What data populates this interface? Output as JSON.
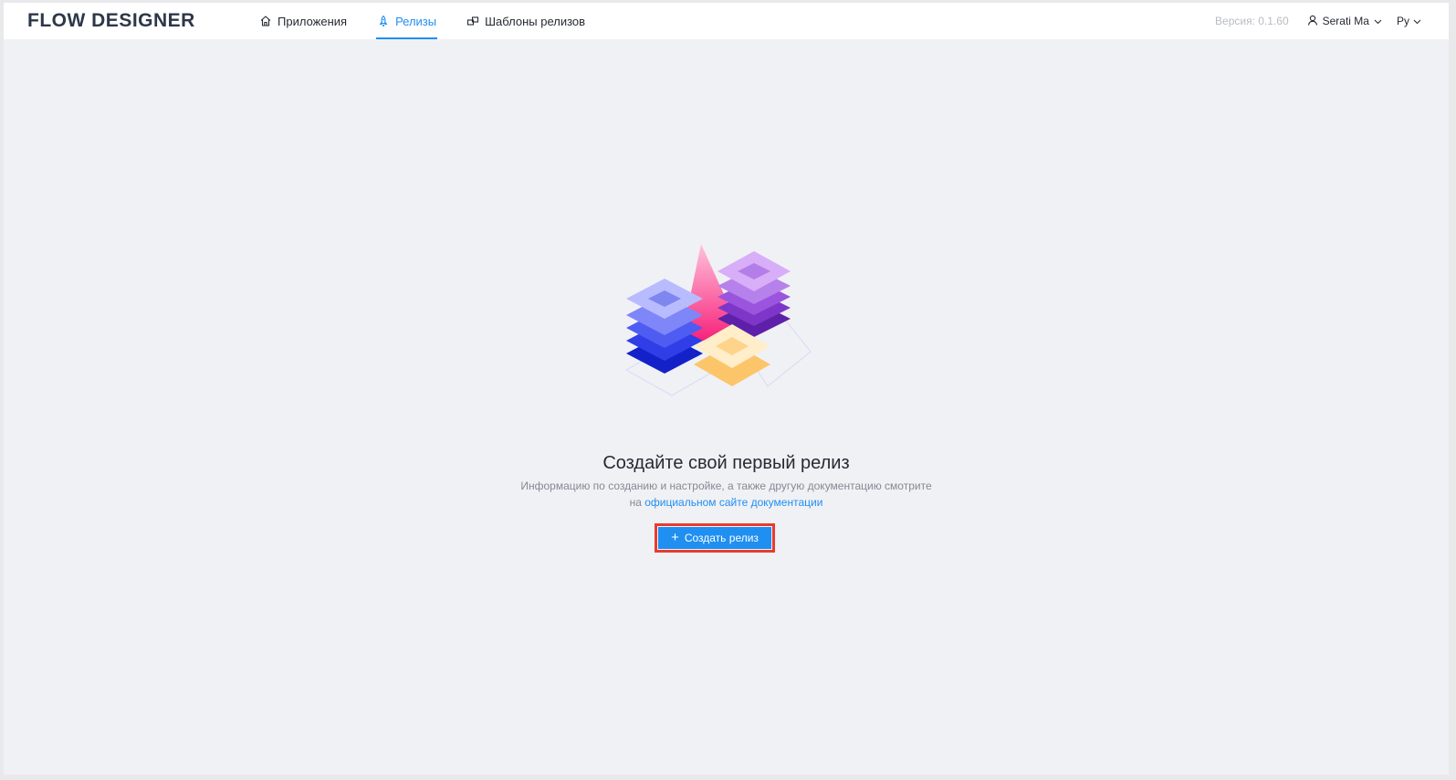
{
  "header": {
    "logo": "FLOW DESIGNER",
    "nav": [
      {
        "label": "Приложения",
        "icon": "home-icon",
        "active": false
      },
      {
        "label": "Релизы",
        "icon": "rocket-icon",
        "active": true
      },
      {
        "label": "Шаблоны релизов",
        "icon": "templates-icon",
        "active": false
      }
    ],
    "version": "Версия: 0.1.60",
    "user": "Serati Ma",
    "language": "Ру"
  },
  "empty_state": {
    "title": "Создайте свой первый релиз",
    "description_line1": "Информацию по созданию и настройке, а также другую документацию смотрите",
    "description_prefix": "на",
    "description_link": "официальном сайте документации",
    "button_label": "Создать релиз",
    "button_icon": "plus-icon"
  },
  "colors": {
    "accent": "#1f8ff2",
    "highlight": "#e93b2e",
    "background": "#f0f1f5"
  }
}
